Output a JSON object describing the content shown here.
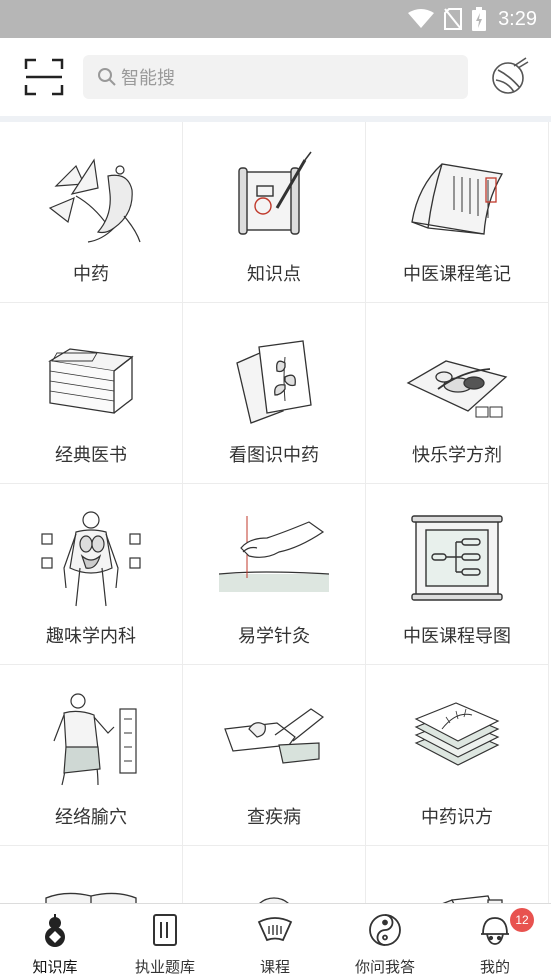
{
  "status_bar": {
    "time": "3:29",
    "icons": [
      "wifi-icon",
      "no-sim-icon",
      "battery-charging-icon"
    ]
  },
  "header": {
    "search_placeholder": "智能搜",
    "left_icon": "scan-icon",
    "right_icon": "app-logo-icon"
  },
  "grid": {
    "items": [
      {
        "label": "中药",
        "icon": "ginseng-herb-icon"
      },
      {
        "label": "知识点",
        "icon": "scroll-brush-icon"
      },
      {
        "label": "中医课程笔记",
        "icon": "open-book-notes-icon"
      },
      {
        "label": "经典医书",
        "icon": "stacked-books-icon"
      },
      {
        "label": "看图识中药",
        "icon": "herb-cards-icon"
      },
      {
        "label": "快乐学方剂",
        "icon": "herbal-formula-icon"
      },
      {
        "label": "趣味学内科",
        "icon": "anatomy-figure-icon"
      },
      {
        "label": "易学针灸",
        "icon": "acupuncture-needle-icon"
      },
      {
        "label": "中医课程导图",
        "icon": "mind-map-scroll-icon"
      },
      {
        "label": "经络腧穴",
        "icon": "meridian-figure-icon"
      },
      {
        "label": "查疾病",
        "icon": "pulse-diagnosis-icon"
      },
      {
        "label": "中药识方",
        "icon": "prescription-leaf-icon"
      },
      {
        "label": "",
        "icon": "open-book-icon"
      },
      {
        "label": "",
        "icon": "round-seal-icon"
      },
      {
        "label": "",
        "icon": "cards-icon"
      }
    ]
  },
  "tabbar": {
    "tabs": [
      {
        "label": "知识库",
        "icon": "gourd-icon",
        "active": true
      },
      {
        "label": "执业题库",
        "icon": "notebook-icon"
      },
      {
        "label": "课程",
        "icon": "fan-icon"
      },
      {
        "label": "你问我答",
        "icon": "yin-yang-icon"
      },
      {
        "label": "我的",
        "icon": "avatar-icon",
        "badge": "12"
      }
    ]
  },
  "colors": {
    "accent_badge": "#e8524f",
    "status_bar": "#b6b6b6",
    "search_bg": "#f2f2f2"
  }
}
